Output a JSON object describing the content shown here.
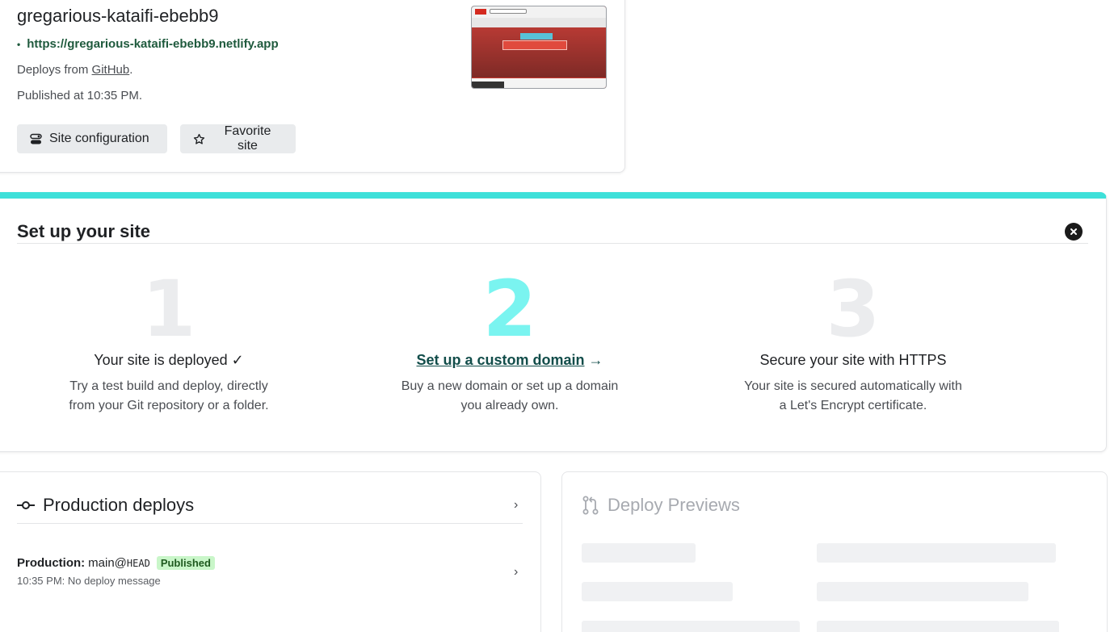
{
  "site": {
    "name": "gregarious-kataifi-ebebb9",
    "url": "https://gregarious-kataifi-ebebb9.netlify.app",
    "deploys_from_prefix": "Deploys from ",
    "deploys_from_link": "GitHub",
    "deploys_from_suffix": ".",
    "published_at": "Published at 10:35 PM.",
    "site_config_label": "Site configuration",
    "favorite_label": "Favorite site"
  },
  "setup": {
    "title": "Set up your site",
    "steps": [
      {
        "number": "1",
        "title": "Your site is deployed ✓",
        "desc": "Try a test build and deploy, directly from your Git repository or a folder."
      },
      {
        "number": "2",
        "title": "Set up a custom domain",
        "arrow": "→",
        "desc": "Buy a new domain or set up a domain you already own."
      },
      {
        "number": "3",
        "title": "Secure your site with HTTPS",
        "desc": "Your site is secured automatically with a Let's Encrypt certificate."
      }
    ]
  },
  "production": {
    "title": "Production deploys",
    "deploy": {
      "label": "Production:",
      "branch": "main@",
      "ref": "HEAD",
      "badge": "Published",
      "time_message": "10:35 PM: No deploy message"
    }
  },
  "previews": {
    "title": "Deploy Previews"
  },
  "icons": {
    "config": "toggle-icon",
    "favorite": "star-icon",
    "close": "close-circle-icon",
    "commit": "git-commit-icon",
    "pull_request": "git-pull-request-icon",
    "chevron": "chevron-right-icon"
  },
  "colors": {
    "accent_teal": "#3ee0d9",
    "step_highlight": "#7af4f0",
    "published_badge": "#c9f6c9",
    "link_green": "#1f5a3d"
  }
}
